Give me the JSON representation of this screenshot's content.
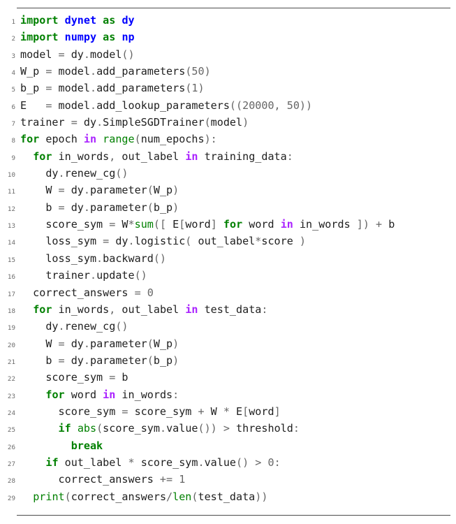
{
  "listing": {
    "language": "python",
    "line_count": 29,
    "colors": {
      "background": "#ffffff",
      "keyword": "#008000",
      "keyword_operator": "#aa22ff",
      "namespace": "#0000ff",
      "builtin": "#008000",
      "operator": "#666666",
      "number": "#666666",
      "text": "#202020",
      "line_number": "#6b6b6b",
      "rule": "#4c4c4c"
    },
    "lines": [
      {
        "no": "1",
        "tokens": [
          {
            "t": "import",
            "c": "kw"
          },
          {
            "t": " ",
            "c": "nm"
          },
          {
            "t": "dynet",
            "c": "nn"
          },
          {
            "t": " ",
            "c": "nm"
          },
          {
            "t": "as",
            "c": "kw"
          },
          {
            "t": " ",
            "c": "nm"
          },
          {
            "t": "dy",
            "c": "nn"
          }
        ]
      },
      {
        "no": "2",
        "tokens": [
          {
            "t": "import",
            "c": "kw"
          },
          {
            "t": " ",
            "c": "nm"
          },
          {
            "t": "numpy",
            "c": "nn"
          },
          {
            "t": " ",
            "c": "nm"
          },
          {
            "t": "as",
            "c": "kw"
          },
          {
            "t": " ",
            "c": "nm"
          },
          {
            "t": "np",
            "c": "nn"
          }
        ]
      },
      {
        "no": "3",
        "tokens": [
          {
            "t": "model ",
            "c": "nm"
          },
          {
            "t": "=",
            "c": "op"
          },
          {
            "t": " dy",
            "c": "nm"
          },
          {
            "t": ".",
            "c": "op"
          },
          {
            "t": "model",
            "c": "nm"
          },
          {
            "t": "()",
            "c": "op"
          }
        ]
      },
      {
        "no": "4",
        "tokens": [
          {
            "t": "W_p ",
            "c": "nm"
          },
          {
            "t": "=",
            "c": "op"
          },
          {
            "t": " model",
            "c": "nm"
          },
          {
            "t": ".",
            "c": "op"
          },
          {
            "t": "add_parameters",
            "c": "nm"
          },
          {
            "t": "(",
            "c": "op"
          },
          {
            "t": "50",
            "c": "mi"
          },
          {
            "t": ")",
            "c": "op"
          }
        ]
      },
      {
        "no": "5",
        "tokens": [
          {
            "t": "b_p ",
            "c": "nm"
          },
          {
            "t": "=",
            "c": "op"
          },
          {
            "t": " model",
            "c": "nm"
          },
          {
            "t": ".",
            "c": "op"
          },
          {
            "t": "add_parameters",
            "c": "nm"
          },
          {
            "t": "(",
            "c": "op"
          },
          {
            "t": "1",
            "c": "mi"
          },
          {
            "t": ")",
            "c": "op"
          }
        ]
      },
      {
        "no": "6",
        "tokens": [
          {
            "t": "E   ",
            "c": "nm"
          },
          {
            "t": "=",
            "c": "op"
          },
          {
            "t": " model",
            "c": "nm"
          },
          {
            "t": ".",
            "c": "op"
          },
          {
            "t": "add_lookup_parameters",
            "c": "nm"
          },
          {
            "t": "((",
            "c": "op"
          },
          {
            "t": "20000",
            "c": "mi"
          },
          {
            "t": ", ",
            "c": "op"
          },
          {
            "t": "50",
            "c": "mi"
          },
          {
            "t": "))",
            "c": "op"
          }
        ]
      },
      {
        "no": "7",
        "tokens": [
          {
            "t": "trainer ",
            "c": "nm"
          },
          {
            "t": "=",
            "c": "op"
          },
          {
            "t": " dy",
            "c": "nm"
          },
          {
            "t": ".",
            "c": "op"
          },
          {
            "t": "SimpleSGDTrainer",
            "c": "nm"
          },
          {
            "t": "(",
            "c": "op"
          },
          {
            "t": "model",
            "c": "nm"
          },
          {
            "t": ")",
            "c": "op"
          }
        ]
      },
      {
        "no": "8",
        "tokens": [
          {
            "t": "for",
            "c": "kw"
          },
          {
            "t": " epoch ",
            "c": "nm"
          },
          {
            "t": "in",
            "c": "kwn"
          },
          {
            "t": " ",
            "c": "nm"
          },
          {
            "t": "range",
            "c": "nb"
          },
          {
            "t": "(",
            "c": "op"
          },
          {
            "t": "num_epochs",
            "c": "nm"
          },
          {
            "t": "):",
            "c": "op"
          }
        ]
      },
      {
        "no": "9",
        "tokens": [
          {
            "t": "  ",
            "c": "nm"
          },
          {
            "t": "for",
            "c": "kw"
          },
          {
            "t": " in_words",
            "c": "nm"
          },
          {
            "t": ",",
            "c": "op"
          },
          {
            "t": " out_label ",
            "c": "nm"
          },
          {
            "t": "in",
            "c": "kwn"
          },
          {
            "t": " training_data",
            "c": "nm"
          },
          {
            "t": ":",
            "c": "op"
          }
        ]
      },
      {
        "no": "10",
        "tokens": [
          {
            "t": "    dy",
            "c": "nm"
          },
          {
            "t": ".",
            "c": "op"
          },
          {
            "t": "renew_cg",
            "c": "nm"
          },
          {
            "t": "()",
            "c": "op"
          }
        ]
      },
      {
        "no": "11",
        "tokens": [
          {
            "t": "    W ",
            "c": "nm"
          },
          {
            "t": "=",
            "c": "op"
          },
          {
            "t": " dy",
            "c": "nm"
          },
          {
            "t": ".",
            "c": "op"
          },
          {
            "t": "parameter",
            "c": "nm"
          },
          {
            "t": "(",
            "c": "op"
          },
          {
            "t": "W_p",
            "c": "nm"
          },
          {
            "t": ")",
            "c": "op"
          }
        ]
      },
      {
        "no": "12",
        "tokens": [
          {
            "t": "    b ",
            "c": "nm"
          },
          {
            "t": "=",
            "c": "op"
          },
          {
            "t": " dy",
            "c": "nm"
          },
          {
            "t": ".",
            "c": "op"
          },
          {
            "t": "parameter",
            "c": "nm"
          },
          {
            "t": "(",
            "c": "op"
          },
          {
            "t": "b_p",
            "c": "nm"
          },
          {
            "t": ")",
            "c": "op"
          }
        ]
      },
      {
        "no": "13",
        "tokens": [
          {
            "t": "    score_sym ",
            "c": "nm"
          },
          {
            "t": "=",
            "c": "op"
          },
          {
            "t": " W",
            "c": "nm"
          },
          {
            "t": "*",
            "c": "op"
          },
          {
            "t": "sum",
            "c": "nb"
          },
          {
            "t": "([",
            "c": "op"
          },
          {
            "t": " E",
            "c": "nm"
          },
          {
            "t": "[",
            "c": "op"
          },
          {
            "t": "word",
            "c": "nm"
          },
          {
            "t": "]",
            "c": "op"
          },
          {
            "t": " ",
            "c": "nm"
          },
          {
            "t": "for",
            "c": "kw"
          },
          {
            "t": " word ",
            "c": "nm"
          },
          {
            "t": "in",
            "c": "kwn"
          },
          {
            "t": " in_words ",
            "c": "nm"
          },
          {
            "t": "])",
            "c": "op"
          },
          {
            "t": " ",
            "c": "nm"
          },
          {
            "t": "+",
            "c": "op"
          },
          {
            "t": " b",
            "c": "nm"
          }
        ]
      },
      {
        "no": "14",
        "tokens": [
          {
            "t": "    loss_sym ",
            "c": "nm"
          },
          {
            "t": "=",
            "c": "op"
          },
          {
            "t": " dy",
            "c": "nm"
          },
          {
            "t": ".",
            "c": "op"
          },
          {
            "t": "logistic",
            "c": "nm"
          },
          {
            "t": "(",
            "c": "op"
          },
          {
            "t": " out_label",
            "c": "nm"
          },
          {
            "t": "*",
            "c": "op"
          },
          {
            "t": "score ",
            "c": "nm"
          },
          {
            "t": ")",
            "c": "op"
          }
        ]
      },
      {
        "no": "15",
        "tokens": [
          {
            "t": "    loss_sym",
            "c": "nm"
          },
          {
            "t": ".",
            "c": "op"
          },
          {
            "t": "backward",
            "c": "nm"
          },
          {
            "t": "()",
            "c": "op"
          }
        ]
      },
      {
        "no": "16",
        "tokens": [
          {
            "t": "    trainer",
            "c": "nm"
          },
          {
            "t": ".",
            "c": "op"
          },
          {
            "t": "update",
            "c": "nm"
          },
          {
            "t": "()",
            "c": "op"
          }
        ]
      },
      {
        "no": "17",
        "tokens": [
          {
            "t": "  correct_answers ",
            "c": "nm"
          },
          {
            "t": "=",
            "c": "op"
          },
          {
            "t": " ",
            "c": "nm"
          },
          {
            "t": "0",
            "c": "mi"
          }
        ]
      },
      {
        "no": "18",
        "tokens": [
          {
            "t": "  ",
            "c": "nm"
          },
          {
            "t": "for",
            "c": "kw"
          },
          {
            "t": " in_words",
            "c": "nm"
          },
          {
            "t": ",",
            "c": "op"
          },
          {
            "t": " out_label ",
            "c": "nm"
          },
          {
            "t": "in",
            "c": "kwn"
          },
          {
            "t": " test_data",
            "c": "nm"
          },
          {
            "t": ":",
            "c": "op"
          }
        ]
      },
      {
        "no": "19",
        "tokens": [
          {
            "t": "    dy",
            "c": "nm"
          },
          {
            "t": ".",
            "c": "op"
          },
          {
            "t": "renew_cg",
            "c": "nm"
          },
          {
            "t": "()",
            "c": "op"
          }
        ]
      },
      {
        "no": "20",
        "tokens": [
          {
            "t": "    W ",
            "c": "nm"
          },
          {
            "t": "=",
            "c": "op"
          },
          {
            "t": " dy",
            "c": "nm"
          },
          {
            "t": ".",
            "c": "op"
          },
          {
            "t": "parameter",
            "c": "nm"
          },
          {
            "t": "(",
            "c": "op"
          },
          {
            "t": "W_p",
            "c": "nm"
          },
          {
            "t": ")",
            "c": "op"
          }
        ]
      },
      {
        "no": "21",
        "tokens": [
          {
            "t": "    b ",
            "c": "nm"
          },
          {
            "t": "=",
            "c": "op"
          },
          {
            "t": " dy",
            "c": "nm"
          },
          {
            "t": ".",
            "c": "op"
          },
          {
            "t": "parameter",
            "c": "nm"
          },
          {
            "t": "(",
            "c": "op"
          },
          {
            "t": "b_p",
            "c": "nm"
          },
          {
            "t": ")",
            "c": "op"
          }
        ]
      },
      {
        "no": "22",
        "tokens": [
          {
            "t": "    score_sym ",
            "c": "nm"
          },
          {
            "t": "=",
            "c": "op"
          },
          {
            "t": " b",
            "c": "nm"
          }
        ]
      },
      {
        "no": "23",
        "tokens": [
          {
            "t": "    ",
            "c": "nm"
          },
          {
            "t": "for",
            "c": "kw"
          },
          {
            "t": " word ",
            "c": "nm"
          },
          {
            "t": "in",
            "c": "kwn"
          },
          {
            "t": " in_words",
            "c": "nm"
          },
          {
            "t": ":",
            "c": "op"
          }
        ]
      },
      {
        "no": "24",
        "tokens": [
          {
            "t": "      score_sym ",
            "c": "nm"
          },
          {
            "t": "=",
            "c": "op"
          },
          {
            "t": " score_sym ",
            "c": "nm"
          },
          {
            "t": "+",
            "c": "op"
          },
          {
            "t": " W ",
            "c": "nm"
          },
          {
            "t": "*",
            "c": "op"
          },
          {
            "t": " E",
            "c": "nm"
          },
          {
            "t": "[",
            "c": "op"
          },
          {
            "t": "word",
            "c": "nm"
          },
          {
            "t": "]",
            "c": "op"
          }
        ]
      },
      {
        "no": "25",
        "tokens": [
          {
            "t": "      ",
            "c": "nm"
          },
          {
            "t": "if",
            "c": "kw"
          },
          {
            "t": " ",
            "c": "nm"
          },
          {
            "t": "abs",
            "c": "nb"
          },
          {
            "t": "(",
            "c": "op"
          },
          {
            "t": "score_sym",
            "c": "nm"
          },
          {
            "t": ".",
            "c": "op"
          },
          {
            "t": "value",
            "c": "nm"
          },
          {
            "t": "())",
            "c": "op"
          },
          {
            "t": " ",
            "c": "nm"
          },
          {
            "t": ">",
            "c": "op"
          },
          {
            "t": " threshold",
            "c": "nm"
          },
          {
            "t": ":",
            "c": "op"
          }
        ]
      },
      {
        "no": "26",
        "tokens": [
          {
            "t": "        ",
            "c": "nm"
          },
          {
            "t": "break",
            "c": "kw"
          }
        ]
      },
      {
        "no": "27",
        "tokens": [
          {
            "t": "    ",
            "c": "nm"
          },
          {
            "t": "if",
            "c": "kw"
          },
          {
            "t": " out_label ",
            "c": "nm"
          },
          {
            "t": "*",
            "c": "op"
          },
          {
            "t": " score_sym",
            "c": "nm"
          },
          {
            "t": ".",
            "c": "op"
          },
          {
            "t": "value",
            "c": "nm"
          },
          {
            "t": "()",
            "c": "op"
          },
          {
            "t": " ",
            "c": "nm"
          },
          {
            "t": ">",
            "c": "op"
          },
          {
            "t": " ",
            "c": "nm"
          },
          {
            "t": "0",
            "c": "mi"
          },
          {
            "t": ":",
            "c": "op"
          }
        ]
      },
      {
        "no": "28",
        "tokens": [
          {
            "t": "      correct_answers ",
            "c": "nm"
          },
          {
            "t": "+=",
            "c": "op"
          },
          {
            "t": " ",
            "c": "nm"
          },
          {
            "t": "1",
            "c": "mi"
          }
        ]
      },
      {
        "no": "29",
        "tokens": [
          {
            "t": "  ",
            "c": "nm"
          },
          {
            "t": "print",
            "c": "nb"
          },
          {
            "t": "(",
            "c": "op"
          },
          {
            "t": "correct_answers",
            "c": "nm"
          },
          {
            "t": "/",
            "c": "op"
          },
          {
            "t": "len",
            "c": "nb"
          },
          {
            "t": "(",
            "c": "op"
          },
          {
            "t": "test_data",
            "c": "nm"
          },
          {
            "t": "))",
            "c": "op"
          }
        ]
      }
    ]
  }
}
